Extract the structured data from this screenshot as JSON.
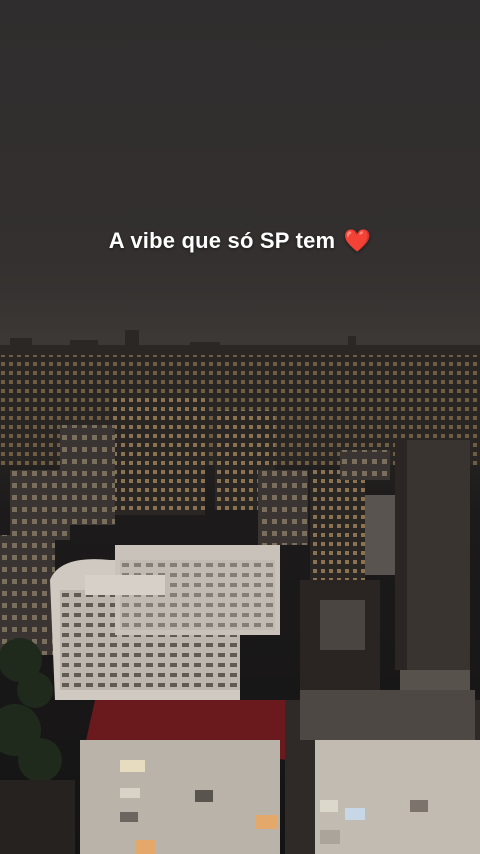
{
  "caption": {
    "text": "A vibe que só SP tem",
    "emoji": "❤️"
  },
  "scene": {
    "subject": "night-city-skyline",
    "sky_color": "#33302f"
  }
}
